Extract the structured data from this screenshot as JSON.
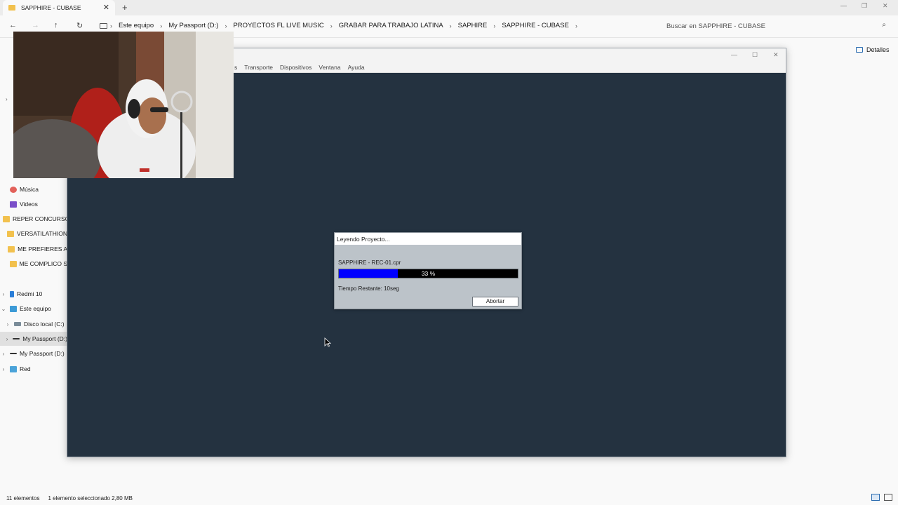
{
  "explorer": {
    "tab_title": "SAPPHIRE  - CUBASE",
    "breadcrumbs": [
      "Este equipo",
      "My Passport (D:)",
      "PROYECTOS FL LIVE MUSIC",
      "GRABAR PARA TRABAJO LATINA",
      "SAPHIRE",
      "SAPPHIRE  - CUBASE"
    ],
    "search_placeholder": "Buscar en SAPPHIRE  - CUBASE",
    "details_label": "Detalles",
    "sidebar": [
      {
        "label": "Música",
        "icon": "music-icon"
      },
      {
        "label": "Videos",
        "icon": "video-icon"
      },
      {
        "label": "REPER CONCURSO",
        "icon": "folder-icon"
      },
      {
        "label": "VERSATILATHION",
        "icon": "folder-icon"
      },
      {
        "label": "ME PREFIERES A",
        "icon": "folder-icon"
      },
      {
        "label": "ME COMPLICO S",
        "icon": "folder-icon"
      },
      {
        "label": "Redmi 10",
        "icon": "phone-icon"
      },
      {
        "label": "Este equipo",
        "icon": "computer-icon"
      },
      {
        "label": "Disco local (C:)",
        "icon": "disk-icon"
      },
      {
        "label": "My Passport (D:)",
        "icon": "drive-icon"
      },
      {
        "label": "My Passport (D:)",
        "icon": "drive-icon"
      },
      {
        "label": "Red",
        "icon": "network-icon"
      }
    ],
    "status": {
      "count": "11 elementos",
      "selection": "1 elemento seleccionado  2,80 MB"
    }
  },
  "cubase": {
    "menu": [
      "s",
      "Transporte",
      "Dispositivos",
      "Ventana",
      "Ayuda"
    ],
    "dialog": {
      "title": "Leyendo Proyecto...",
      "file": "SAPPHIRE - REC-01.cpr",
      "progress_percent": 33,
      "progress_label": "33 %",
      "time_remaining": "Tiempo Restante: 10seg",
      "abort_label": "Abortar"
    },
    "colors": {
      "workspace": "#243240",
      "progress_fill": "#0000ff",
      "progress_track": "#000000"
    }
  }
}
